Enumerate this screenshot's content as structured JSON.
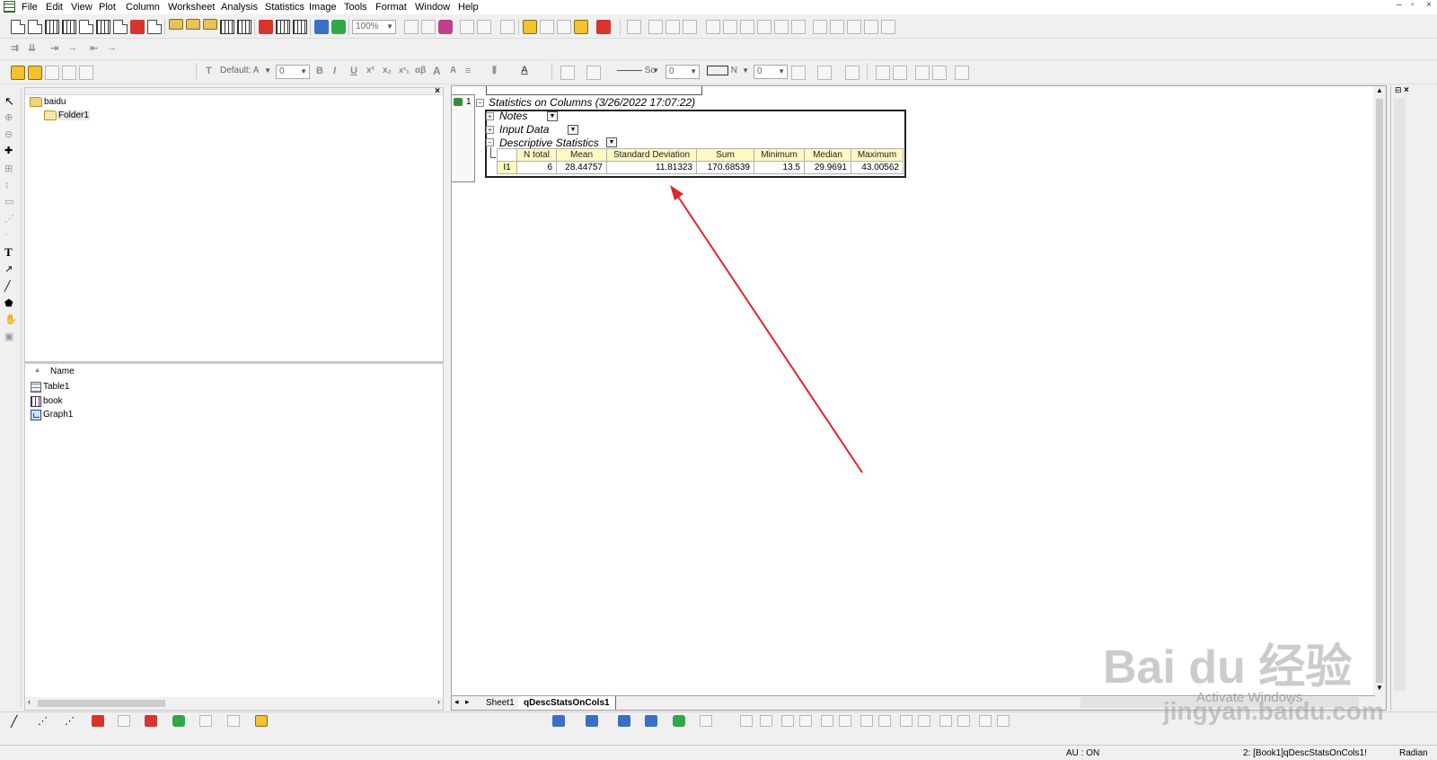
{
  "menu": [
    "File",
    "Edit",
    "View",
    "Plot",
    "Column",
    "Worksheet",
    "Analysis",
    "Statistics",
    "Image",
    "Tools",
    "Format",
    "Window",
    "Help"
  ],
  "window_controls": [
    "–",
    "▫",
    "×"
  ],
  "toolbar": {
    "zoom": "100%",
    "font_name": "Default: A",
    "font_size": "0",
    "line_style": "So",
    "line_width": "0",
    "fill_label": "N",
    "fill_value": "0"
  },
  "format_glyphs": [
    "B",
    "I",
    "U",
    "x²",
    "x₂",
    "x²₁",
    "αβ",
    "A",
    "A"
  ],
  "explorer": {
    "root": "baidu",
    "folder": "Folder1",
    "list_header": "Name",
    "items": [
      {
        "name": "Table1",
        "icon": "table-icon"
      },
      {
        "name": "book",
        "icon": "workbook-icon"
      },
      {
        "name": "Graph1",
        "icon": "graph-icon"
      }
    ]
  },
  "report": {
    "row_number": "1",
    "title": "Statistics on Columns (3/26/2022 17:07:22)",
    "sections": [
      "Notes",
      "Input Data",
      "Descriptive Statistics"
    ],
    "table": {
      "headers": [
        "N total",
        "Mean",
        "Standard Deviation",
        "Sum",
        "Minimum",
        "Median",
        "Maximum"
      ],
      "rows": [
        {
          "label": "I1",
          "values": [
            "6",
            "28.44757",
            "11.81323",
            "170.68539",
            "13.5",
            "29.9691",
            "43.00562"
          ]
        }
      ]
    }
  },
  "sheet_tabs": [
    "Sheet1",
    "qDescStatsOnCols1"
  ],
  "status": {
    "au": "AU : ON",
    "active": "2: [Book1]qDescStatsOnCols1!",
    "angle": "Radian"
  },
  "watermark": {
    "brand": "Bai du 经验",
    "url": "jingyan.baidu.com",
    "activate": "Activate Windows"
  },
  "colors": {
    "annotation_arrow": "#e0262b",
    "header_fill": "#fff9c2"
  }
}
